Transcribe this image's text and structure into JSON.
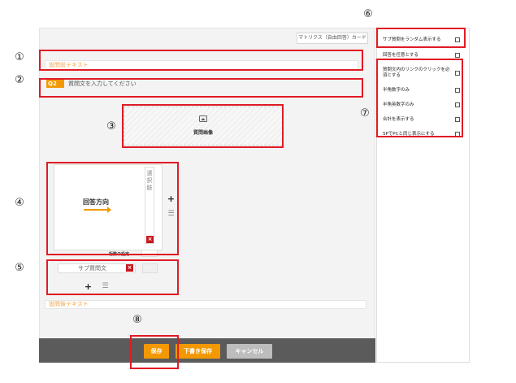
{
  "editor": {
    "card_label": "マトリクス（自由回答）カード",
    "pre_text_placeholder": "設問前テキスト",
    "question_badge": "Q2",
    "question_placeholder": "質問文を入力してください",
    "image_label": "質問画像",
    "answer_direction": "回答方向",
    "choice_label": "選択肢",
    "digits_label": "桁数の設定",
    "sub_question_placeholder": "サブ質問文",
    "delete_mark": "×",
    "plus_mark": "+",
    "list_mark": "☰",
    "post_text_placeholder": "設問後テキスト"
  },
  "footer": {
    "save_label": "保存",
    "draft_label": "下書き保存",
    "cancel_label": "キャンセル"
  },
  "settings": {
    "items": [
      {
        "label": "サブ質問をランダム表示する",
        "checked": false
      },
      {
        "label": "回答を任意とする",
        "checked": false
      },
      {
        "label": "質問文内のリンクのクリックを必須とする",
        "checked": false
      },
      {
        "label": "半角数字のみ",
        "checked": false
      },
      {
        "label": "半角英数字のみ",
        "checked": false
      },
      {
        "label": "合計を表示する",
        "checked": false
      },
      {
        "label": "SPでPCと同じ表示にする",
        "checked": false
      }
    ]
  },
  "annotations": [
    "①",
    "②",
    "③",
    "④",
    "⑤",
    "⑥",
    "⑦",
    "⑧"
  ],
  "colors": {
    "accent": "#f39800",
    "annotation_red": "#e01b24",
    "delete_red": "#c9161d",
    "footer_bg": "#5b5b5b",
    "cancel_gray": "#bdbdbd"
  }
}
